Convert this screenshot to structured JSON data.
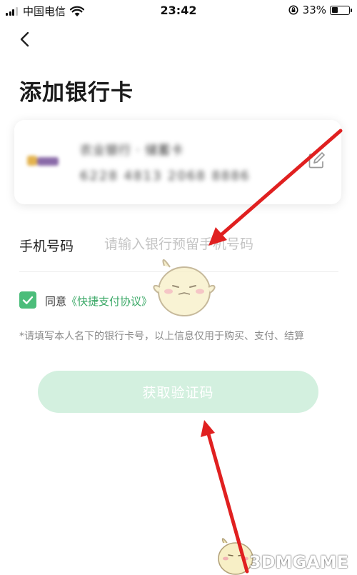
{
  "status_bar": {
    "carrier": "中国电信",
    "time": "23:42",
    "battery": "33%",
    "icons": [
      "signal-icon",
      "wifi-icon",
      "rotation-lock-icon",
      "battery-icon"
    ]
  },
  "header": {
    "back_icon": "chevron-left-icon",
    "title": "添加银行卡"
  },
  "bank_card": {
    "name": "农业银行 · 储蓄卡",
    "number": "6228 4813 2068 8886",
    "edit_icon": "edit-icon"
  },
  "phone": {
    "label": "手机号码",
    "placeholder": "请输入银行预留手机号码",
    "value": ""
  },
  "agreement": {
    "checked": true,
    "prefix": "同意",
    "link": "《快捷支付协议》"
  },
  "notice": "*请填写本人名下的银行卡号，以上信息仅用于购买、支付、结算",
  "submit": {
    "label": "获取验证码"
  },
  "watermark": "3DMGAME",
  "colors": {
    "accent": "#4bbd7a",
    "button_bg": "#d3f0df",
    "annotation_arrow": "#e02020"
  }
}
